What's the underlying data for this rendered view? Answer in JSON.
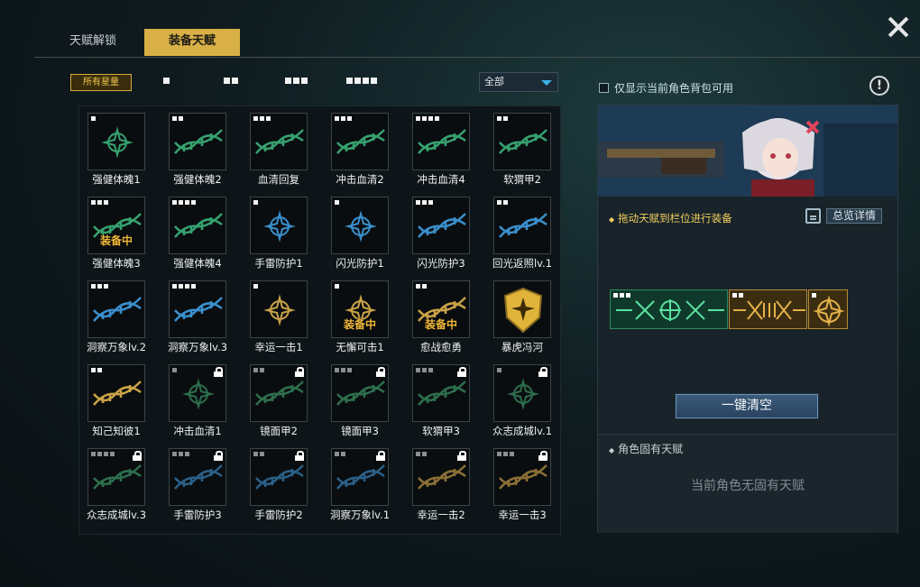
{
  "tabs": [
    {
      "label": "天赋解锁"
    },
    {
      "label": "装备天赋"
    }
  ],
  "filters": {
    "all_label": "所有星量",
    "dropdown_value": "全部"
  },
  "grid": {
    "cards": [
      {
        "name": "强健体魄1",
        "dots": 1,
        "color": "#36a16f",
        "icon": "compass",
        "locked": false,
        "equipped": false
      },
      {
        "name": "强健体魄2",
        "dots": 2,
        "color": "#36a16f",
        "icon": "helix",
        "locked": false,
        "equipped": false
      },
      {
        "name": "血清回复",
        "dots": 3,
        "color": "#36a16f",
        "icon": "helix",
        "locked": false,
        "equipped": false
      },
      {
        "name": "冲击血清2",
        "dots": 3,
        "color": "#36a16f",
        "icon": "helix",
        "locked": false,
        "equipped": false
      },
      {
        "name": "冲击血清4",
        "dots": 4,
        "color": "#36a16f",
        "icon": "helix",
        "locked": false,
        "equipped": false
      },
      {
        "name": "软猬甲2",
        "dots": 2,
        "color": "#36a16f",
        "icon": "helix",
        "locked": false,
        "equipped": false
      },
      {
        "name": "强健体魄3",
        "dots": 3,
        "color": "#36a16f",
        "icon": "helix",
        "locked": false,
        "equipped": true
      },
      {
        "name": "强健体魄4",
        "dots": 4,
        "color": "#36a16f",
        "icon": "helix",
        "locked": false,
        "equipped": false
      },
      {
        "name": "手雷防护1",
        "dots": 1,
        "color": "#3a8fcc",
        "icon": "compass",
        "locked": false,
        "equipped": false
      },
      {
        "name": "闪光防护1",
        "dots": 1,
        "color": "#3a8fcc",
        "icon": "compass",
        "locked": false,
        "equipped": false
      },
      {
        "name": "闪光防护3",
        "dots": 3,
        "color": "#3a8fcc",
        "icon": "helix",
        "locked": false,
        "equipped": false
      },
      {
        "name": "回光返照lv.1",
        "dots": 2,
        "color": "#3a8fcc",
        "icon": "helix",
        "locked": false,
        "equipped": false
      },
      {
        "name": "洞察万象lv.2",
        "dots": 3,
        "color": "#3a8fcc",
        "icon": "helix",
        "locked": false,
        "equipped": false
      },
      {
        "name": "洞察万象lv.3",
        "dots": 4,
        "color": "#3a8fcc",
        "icon": "helix",
        "locked": false,
        "equipped": false
      },
      {
        "name": "幸运一击1",
        "dots": 1,
        "color": "#c9a247",
        "icon": "compass",
        "locked": false,
        "equipped": false
      },
      {
        "name": "无懈可击1",
        "dots": 1,
        "color": "#c9a247",
        "icon": "compass",
        "locked": false,
        "equipped": true
      },
      {
        "name": "愈战愈勇",
        "dots": 2,
        "color": "#c9a247",
        "icon": "helix",
        "locked": false,
        "equipped": true
      },
      {
        "name": "暴虎冯河",
        "dots": 0,
        "color": "#e0b33a",
        "icon": "emblem",
        "locked": false,
        "equipped": false
      },
      {
        "name": "知己知彼1",
        "dots": 2,
        "color": "#c9a247",
        "icon": "helix",
        "locked": false,
        "equipped": false
      },
      {
        "name": "冲击血清1",
        "dots": 1,
        "color": "#2d6e4c",
        "icon": "compass",
        "locked": true,
        "equipped": false
      },
      {
        "name": "镜面甲2",
        "dots": 2,
        "color": "#2d6e4c",
        "icon": "helix",
        "locked": true,
        "equipped": false
      },
      {
        "name": "镜面甲3",
        "dots": 3,
        "color": "#2d6e4c",
        "icon": "helix",
        "locked": true,
        "equipped": false
      },
      {
        "name": "软猬甲3",
        "dots": 3,
        "color": "#2d6e4c",
        "icon": "helix",
        "locked": true,
        "equipped": false
      },
      {
        "name": "众志成城lv.1",
        "dots": 1,
        "color": "#2d6e4c",
        "icon": "compass",
        "locked": true,
        "equipped": false
      },
      {
        "name": "众志成城lv.3",
        "dots": 4,
        "color": "#2d6e4c",
        "icon": "helix",
        "locked": true,
        "equipped": false
      },
      {
        "name": "手雷防护3",
        "dots": 3,
        "color": "#2b5f86",
        "icon": "helix",
        "locked": true,
        "equipped": false
      },
      {
        "name": "手雷防护2",
        "dots": 2,
        "color": "#2b5f86",
        "icon": "helix",
        "locked": true,
        "equipped": false
      },
      {
        "name": "洞察万象lv.1",
        "dots": 2,
        "color": "#2b5f86",
        "icon": "helix",
        "locked": true,
        "equipped": false
      },
      {
        "name": "幸运一击2",
        "dots": 2,
        "color": "#8a6f35",
        "icon": "helix",
        "locked": true,
        "equipped": false
      },
      {
        "name": "幸运一击3",
        "dots": 3,
        "color": "#8a6f35",
        "icon": "helix",
        "locked": true,
        "equipped": false
      }
    ],
    "equipped_label": "装备中"
  },
  "side": {
    "only_available_label": "仅显示当前角色背包可用",
    "drag_hint": "拖动天赋到栏位进行装备",
    "overview_label": "总览详情",
    "clear_button": "一键清空",
    "innate_title": "角色固有天赋",
    "innate_empty": "当前角色无固有天赋"
  }
}
